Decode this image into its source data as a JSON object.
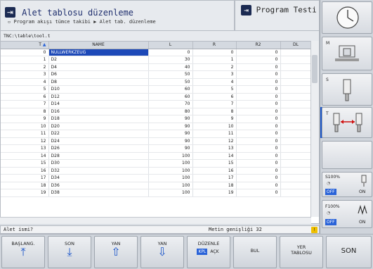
{
  "header": {
    "mode_title": "Alet tablosu düzenleme",
    "sub_mode": "Program akışı tümce takibi",
    "breadcrumb_target": "Alet tab. düzenleme",
    "program_title": "Program Testi"
  },
  "path": "TNC:\\table\\tool.t",
  "table": {
    "columns": [
      "T",
      "NAME",
      "L",
      "R",
      "R2",
      "DL"
    ],
    "rows": [
      [
        "0",
        "NULLWERKZEUG",
        "0",
        "0",
        "0",
        ""
      ],
      [
        "1",
        "D2",
        "30",
        "1",
        "0",
        ""
      ],
      [
        "2",
        "D4",
        "40",
        "2",
        "0",
        ""
      ],
      [
        "3",
        "D6",
        "50",
        "3",
        "0",
        ""
      ],
      [
        "4",
        "D8",
        "50",
        "4",
        "0",
        ""
      ],
      [
        "5",
        "D10",
        "60",
        "5",
        "0",
        ""
      ],
      [
        "6",
        "D12",
        "60",
        "6",
        "0",
        ""
      ],
      [
        "7",
        "D14",
        "70",
        "7",
        "0",
        ""
      ],
      [
        "8",
        "D16",
        "80",
        "8",
        "0",
        ""
      ],
      [
        "9",
        "D18",
        "90",
        "9",
        "0",
        ""
      ],
      [
        "10",
        "D20",
        "90",
        "10",
        "0",
        ""
      ],
      [
        "11",
        "D22",
        "90",
        "11",
        "0",
        ""
      ],
      [
        "12",
        "D24",
        "90",
        "12",
        "0",
        ""
      ],
      [
        "13",
        "D26",
        "90",
        "13",
        "0",
        ""
      ],
      [
        "14",
        "D28",
        "100",
        "14",
        "0",
        ""
      ],
      [
        "15",
        "D30",
        "100",
        "15",
        "0",
        ""
      ],
      [
        "16",
        "D32",
        "100",
        "16",
        "0",
        ""
      ],
      [
        "17",
        "D34",
        "100",
        "17",
        "0",
        ""
      ],
      [
        "18",
        "D36",
        "100",
        "18",
        "0",
        ""
      ],
      [
        "19",
        "D38",
        "100",
        "19",
        "0",
        ""
      ]
    ]
  },
  "status": {
    "prompt": "Alet ismi?",
    "width_info": "Metin genişliği 32",
    "warn": "!"
  },
  "softkeys": {
    "begin": "BAŞLANG.",
    "end": "SON",
    "page_up": "YAN",
    "page_down": "YAN",
    "edit": "DÜZENLE",
    "edit_off": "KPL",
    "edit_on": "AÇK",
    "find": "BUL",
    "place_1": "YER",
    "place_2": "TABLOSU",
    "end_main": "SON"
  },
  "right_panel": {
    "m_label": "M",
    "s_label": "S",
    "t_label": "T",
    "s_override": "S100%",
    "f_override": "F100%",
    "off": "OFF",
    "on": "ON"
  }
}
